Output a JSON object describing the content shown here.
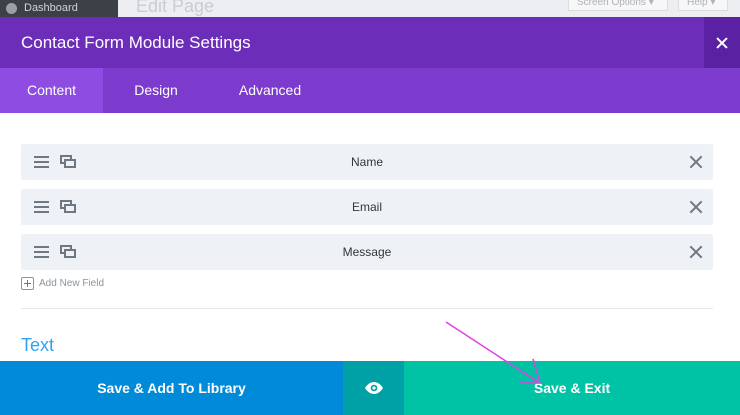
{
  "background": {
    "admin_label": "Dashboard",
    "page_title": "Edit Page",
    "screen_options": "Screen Options ▾",
    "help": "Help ▾"
  },
  "modal": {
    "title": "Contact Form Module Settings",
    "close_icon": "close-icon"
  },
  "tabs": [
    {
      "label": "Content",
      "active": true
    },
    {
      "label": "Design",
      "active": false
    },
    {
      "label": "Advanced",
      "active": false
    }
  ],
  "fields": [
    {
      "label": "Name"
    },
    {
      "label": "Email"
    },
    {
      "label": "Message"
    }
  ],
  "add_field_label": "Add New Field",
  "section_title": "Text",
  "footer": {
    "library_label": "Save & Add To Library",
    "preview_icon": "eye-icon",
    "save_label": "Save & Exit"
  },
  "colors": {
    "header": "#6c2eb9",
    "tab_bar": "#7c3bcc",
    "active_tab": "#8f4ce3",
    "library_button": "#008ad8",
    "preview_button": "#00a0a7",
    "save_button": "#00c3a6",
    "section_title": "#2ea3f2",
    "annotation_arrow": "#e040e0"
  }
}
